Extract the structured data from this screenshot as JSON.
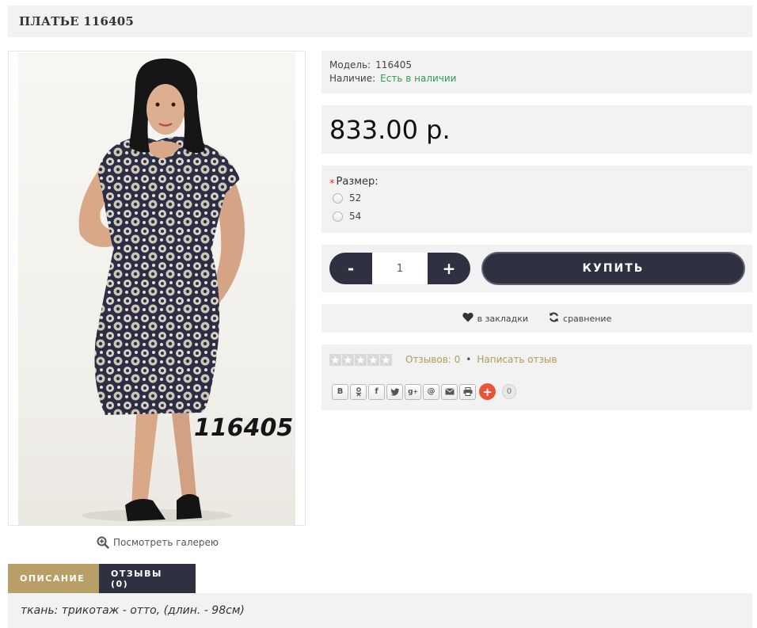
{
  "product": {
    "title": "ПЛАТЬЕ 116405",
    "image_caption": "116405",
    "gallery_link": "Посмотреть галерею"
  },
  "info": {
    "model_label": "Модель:",
    "model_value": "116405",
    "availability_label": "Наличие:",
    "availability_value": "Есть в наличии",
    "price": "833.00 р."
  },
  "options": {
    "size_label": "Размер:",
    "required_mark": "*",
    "sizes": [
      "52",
      "54"
    ]
  },
  "cart": {
    "minus": "-",
    "quantity": "1",
    "plus": "+",
    "buy_label": "КУПИТЬ"
  },
  "actions": {
    "wishlist": "в закладки",
    "compare": "сравнение"
  },
  "reviews": {
    "rating": 0,
    "rating_max": 5,
    "count_label": "Отзывов: 0",
    "separator": "•",
    "write_label": "Написать отзыв"
  },
  "share": {
    "buttons": [
      "vk-icon",
      "odnoklassniki-icon",
      "facebook-icon",
      "twitter-icon",
      "google-plus-icon",
      "mail-at-icon",
      "email-icon",
      "print-icon"
    ],
    "count": "0"
  },
  "tabs": [
    {
      "label": "ОПИСАНИЕ",
      "active": true
    },
    {
      "label": "ОТЗЫВЫ (0)",
      "active": false
    }
  ],
  "description": "ткань: трикотаж - отто, (длин. - 98см)",
  "colors": {
    "panel_bg": "#f2f2f2",
    "dark_button": "#2f3140",
    "accent_tab": "#b79f67",
    "in_stock": "#2e9e4f",
    "review_link": "#b39a5b",
    "share_plus": "#e8533a"
  }
}
